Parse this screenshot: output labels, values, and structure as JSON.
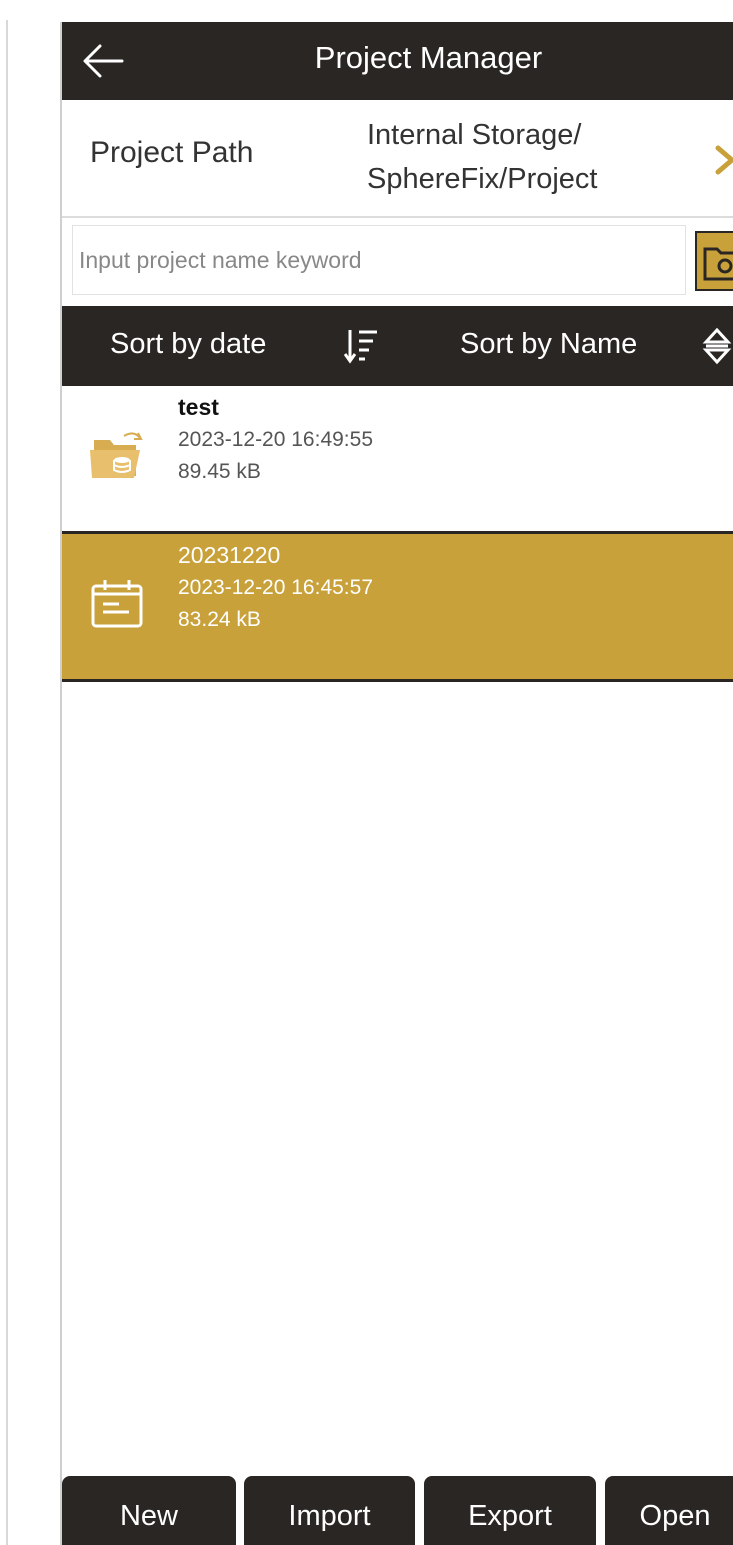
{
  "header": {
    "title": "Project Manager"
  },
  "path": {
    "label": "Project Path",
    "value_line1": "Internal Storage/",
    "value_line2": "SphereFix/Project"
  },
  "search": {
    "placeholder": "Input project name keyword"
  },
  "sort": {
    "by_date": "Sort by date",
    "by_name": "Sort by Name"
  },
  "projects": [
    {
      "name": "test",
      "date": "2023-12-20 16:49:55",
      "size": "89.45 kB",
      "icon": "folder-database-icon",
      "selected": false
    },
    {
      "name": "20231220",
      "date": "2023-12-20 16:45:57",
      "size": "83.24 kB",
      "icon": "calendar-doc-icon",
      "selected": true
    }
  ],
  "footer": {
    "new": "New",
    "import": "Import",
    "export": "Export",
    "open": "Open"
  },
  "colors": {
    "dark": "#2a2624",
    "accent": "#c9a13a",
    "white": "#ffffff"
  }
}
